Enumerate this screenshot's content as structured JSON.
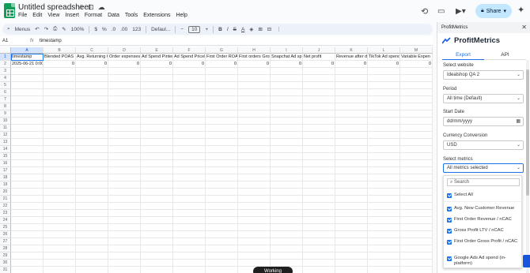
{
  "document": {
    "title": "Untitled spreadsheet",
    "menus": [
      "File",
      "Edit",
      "View",
      "Insert",
      "Format",
      "Data",
      "Tools",
      "Extensions",
      "Help"
    ],
    "share_label": "Share"
  },
  "toolbar": {
    "search_label": "Menus",
    "zoom": "100%",
    "currency": "$",
    "percent": "%",
    "dec_dec": ".0",
    "dec_inc": ".00",
    "number_format": "123",
    "font": "Defaul...",
    "font_size": "10",
    "bold": "B",
    "italic": "I",
    "strike": "S",
    "text_color": "A"
  },
  "formula_bar": {
    "name_box": "A1",
    "content": "timestamp"
  },
  "sheet": {
    "columns": [
      "A",
      "B",
      "C",
      "D",
      "E",
      "F",
      "G",
      "H",
      "I",
      "J",
      "K",
      "L",
      "M"
    ],
    "row_count": 32,
    "header_row": [
      "timestamp",
      "Blended POAS",
      "Avg. Returning C",
      "Order expenses",
      "Ad Spend Pinter",
      "Ad Spend Pricel",
      "First Order ROA",
      "First orders Gros",
      "Snapchat Ad sp",
      "Net profit",
      "Revenue after di",
      "TikTok Ad spend",
      "Variable Expen"
    ],
    "data_row": [
      "2025-06-21 0:00",
      "0",
      "0",
      "0",
      "0",
      "0",
      "0",
      "0",
      "0",
      "0",
      "0",
      "0",
      "0"
    ],
    "status_pill": "Working"
  },
  "panel": {
    "header": "ProfitMetrics",
    "brand": "ProfitMetrics",
    "tabs": [
      "Export",
      "API"
    ],
    "website_label": "Select website",
    "website_value": "Idealshop QA 2",
    "period_label": "Period",
    "period_value": "All time (Default)",
    "start_label": "Start Date",
    "start_value": "dd/mm/yyyy",
    "currency_label": "Currency Conversion",
    "currency_value": "USD",
    "metrics_label": "Select metrics",
    "metrics_value": "All metrics selected",
    "search_placeholder": "Search",
    "select_all": "Select All",
    "metrics": [
      "Avg. New Customer Revenue",
      "First Order Revenue / nCAC",
      "Gross Profit LTV / nCAC",
      "First Order Gross Profit / nCAC",
      "Google Ads Ad spend (in-platform)"
    ]
  },
  "colors": {
    "accent": "#1a73e8",
    "share_bg": "#c2e7ff",
    "sheets_green": "#0f9d58"
  }
}
